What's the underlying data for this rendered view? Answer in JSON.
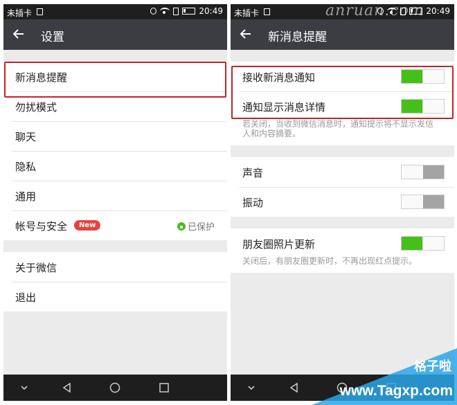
{
  "statusbar": {
    "carrier": "未插卡",
    "time": "20:49"
  },
  "left_screen": {
    "title": "设置",
    "groups": [
      {
        "items": [
          {
            "label": "新消息提醒"
          },
          {
            "label": "勿扰模式"
          },
          {
            "label": "聊天"
          },
          {
            "label": "隐私"
          },
          {
            "label": "通用"
          },
          {
            "label": "帐号与安全",
            "badge": "New",
            "status": "已保护"
          }
        ]
      },
      {
        "items": [
          {
            "label": "关于微信"
          },
          {
            "label": "退出"
          }
        ]
      }
    ]
  },
  "right_screen": {
    "title": "新消息提醒",
    "groups": [
      {
        "items": [
          {
            "label": "接收新消息通知",
            "toggle": "on"
          },
          {
            "label": "通知显示消息详情",
            "toggle": "on"
          }
        ],
        "note": "若关闭，当收到微信消息时，通知提示将不显示发信人和内容摘要。"
      },
      {
        "items": [
          {
            "label": "声音",
            "toggle": "off"
          },
          {
            "label": "振动",
            "toggle": "off"
          }
        ]
      },
      {
        "items": [
          {
            "label": "朋友圈照片更新",
            "toggle": "on"
          }
        ],
        "note": "关闭后，有朋友圈更新时，不再出现红点提示。"
      }
    ]
  },
  "watermarks": {
    "top": "anruan.com",
    "corner_line1": "格子啦",
    "corner_line2": "www.Tagxp.com"
  },
  "colors": {
    "toggle_on": "#45c01a",
    "toggle_off": "#a4a4a4",
    "highlight_box": "#c02328",
    "titlebar": "#3b3d43"
  }
}
